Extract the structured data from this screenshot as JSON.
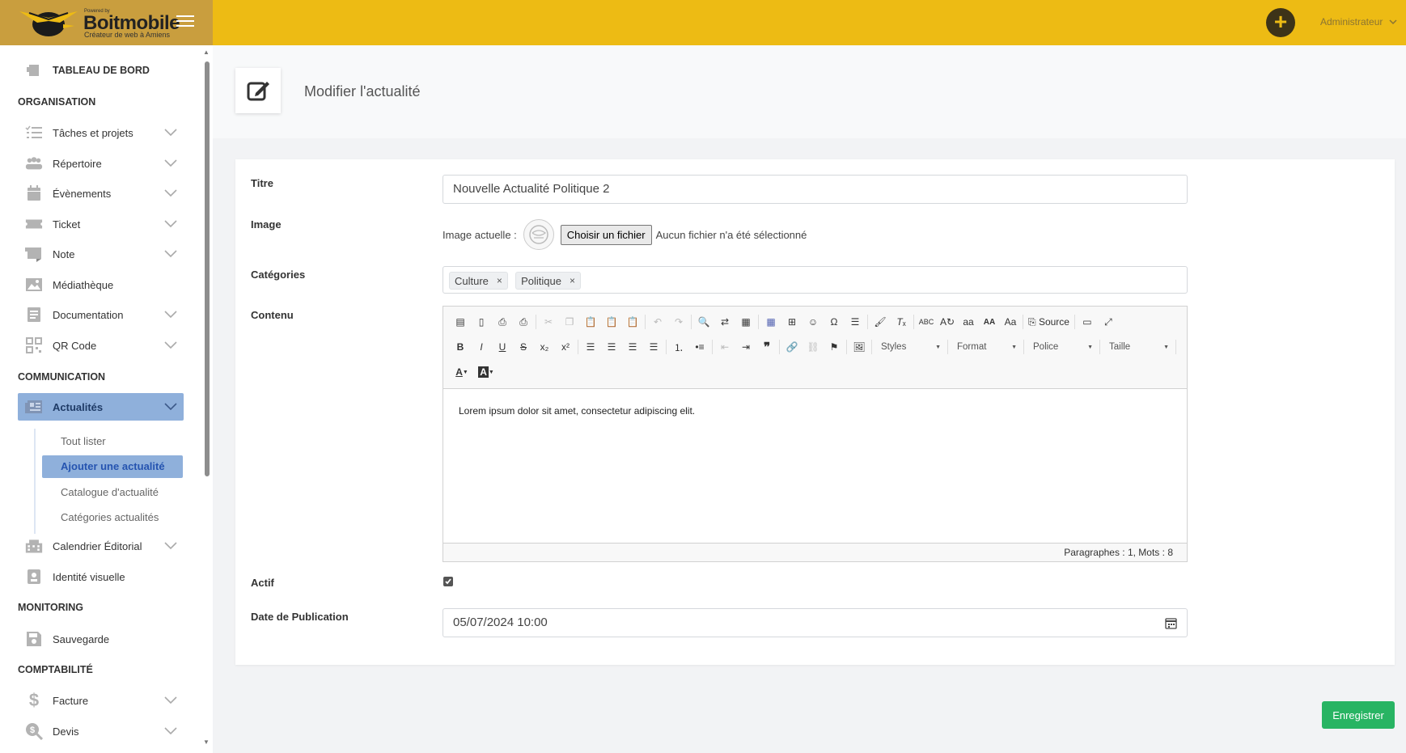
{
  "brand": {
    "powered": "Powered by",
    "name": "Boitmobile",
    "tagline": "Créateur de web à Amiens"
  },
  "topbar": {
    "plus": "+",
    "user": "Administrateur"
  },
  "sidebar": {
    "dashboard": "TABLEAU DE BORD",
    "sections": [
      "ORGANISATION",
      "COMMUNICATION",
      "MONITORING",
      "COMPTABILITÉ"
    ],
    "items": [
      {
        "label": "Tâches et projets"
      },
      {
        "label": "Répertoire"
      },
      {
        "label": "Évènements"
      },
      {
        "label": "Ticket"
      },
      {
        "label": "Note"
      },
      {
        "label": "Médiathèque"
      },
      {
        "label": "Documentation"
      },
      {
        "label": "QR Code"
      },
      {
        "label": "Actualités"
      },
      {
        "label": "Calendrier Éditorial"
      },
      {
        "label": "Identité visuelle"
      },
      {
        "label": "Sauvegarde"
      },
      {
        "label": "Facture"
      },
      {
        "label": "Devis"
      }
    ],
    "sub": [
      "Tout lister",
      "Ajouter une actualité",
      "Catalogue d'actualité",
      "Catégories actualités"
    ]
  },
  "page": {
    "title": "Modifier l'actualité"
  },
  "form": {
    "labels": {
      "title": "Titre",
      "image": "Image",
      "categories": "Catégories",
      "content": "Contenu",
      "active": "Actif",
      "date": "Date de Publication"
    },
    "title_value": "Nouvelle Actualité Politique 2",
    "image": {
      "current": "Image actuelle :",
      "choose": "Choisir un fichier",
      "none": "Aucun fichier n'a été sélectionné"
    },
    "categories": [
      "Culture",
      "Politique"
    ],
    "tag_remove": "×",
    "editor": {
      "source": "Source",
      "styles": "Styles",
      "format": "Format",
      "font": "Police",
      "size": "Taille",
      "body": "Lorem ipsum dolor sit amet, consectetur adipiscing elit.",
      "status": "Paragraphes : 1, Mots : 8"
    },
    "active": true,
    "date_value": "05/07/2024 10:00"
  },
  "save_label": "Enregistrer",
  "colors": {
    "topbar": "#edbb14",
    "logo_bg": "#c99e3e",
    "active": "#8fb0db",
    "save": "#28b463"
  }
}
